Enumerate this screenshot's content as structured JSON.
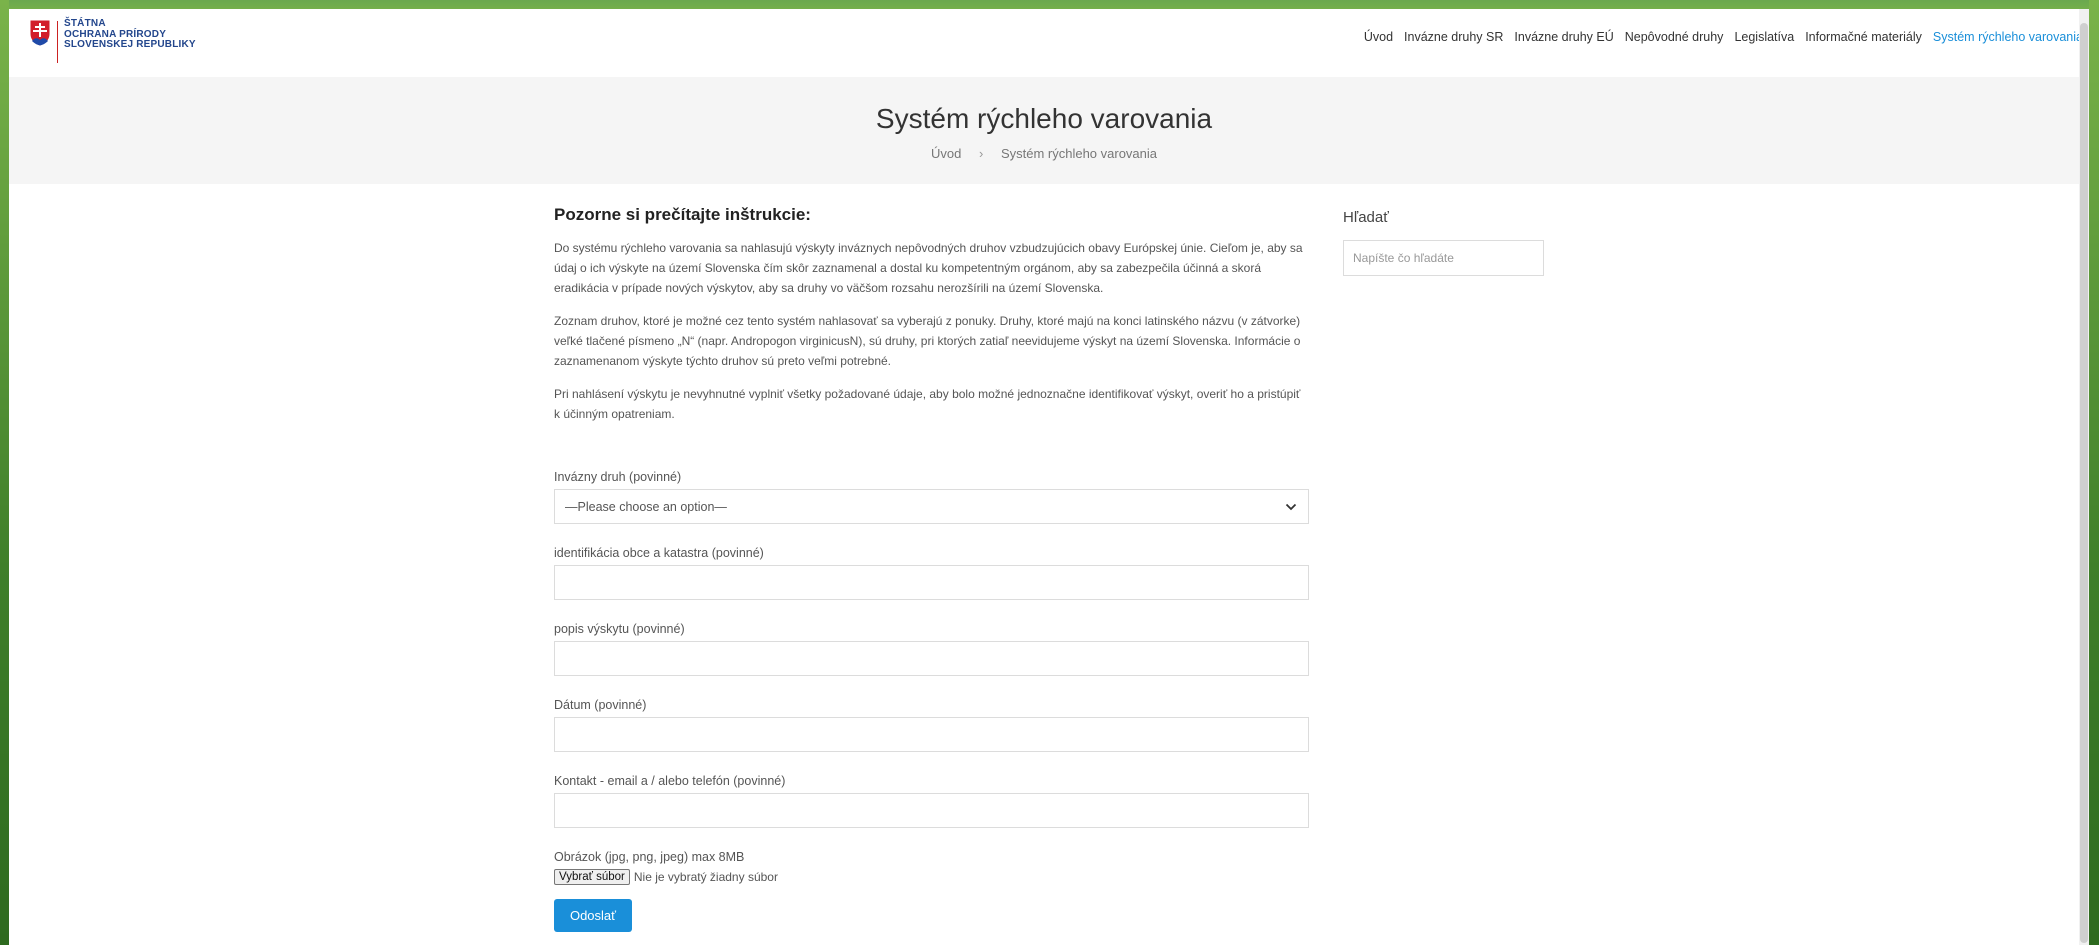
{
  "logo": {
    "line1": "ŠTÁTNA",
    "line2": "OCHRANA PRÍRODY",
    "line3": "SLOVENSKEJ REPUBLIKY"
  },
  "nav": {
    "items": [
      {
        "label": "Úvod"
      },
      {
        "label": "Invázne druhy SR"
      },
      {
        "label": "Invázne druhy EÚ"
      },
      {
        "label": "Nepôvodné druhy"
      },
      {
        "label": "Legislatíva"
      },
      {
        "label": "Informačné materiály"
      },
      {
        "label": "Systém rýchleho varovania"
      }
    ]
  },
  "page": {
    "title": "Systém rýchleho varovania",
    "breadcrumb": {
      "home": "Úvod",
      "separator": "›",
      "current": "Systém rýchleho varovania"
    }
  },
  "instructions": {
    "title": "Pozorne si prečítajte inštrukcie:",
    "paragraphs": [
      "Do systému rýchleho varovania sa nahlasujú výskyty inváznych nepôvodných druhov vzbudzujúcich obavy Európskej únie. Cieľom je, aby sa údaj o ich výskyte na území Slovenska čím skôr zaznamenal a dostal ku kompetentným orgánom, aby sa zabezpečila účinná a skorá eradikácia v prípade nových výskytov, aby sa druhy vo väčšom rozsahu nerozšírili na území Slovenska.",
      "Zoznam druhov, ktoré je možné cez tento systém nahlasovať sa vyberajú z ponuky.  Druhy, ktoré majú na konci latinského názvu (v zátvorke) veľké tlačené písmeno „N“ (napr. Andropogon virginicusN), sú druhy, pri ktorých zatiaľ neevidujeme výskyt na území Slovenska. Informácie o zaznamenanom výskyte týchto druhov sú preto veľmi potrebné.",
      "Pri nahlásení výskytu je nevyhnutné vyplniť všetky požadované údaje, aby bolo možné jednoznačne identifikovať výskyt, overiť ho a pristúpiť k účinným opatreniam."
    ]
  },
  "form": {
    "species": {
      "label": "Invázny druh (povinné)",
      "selected": "—Please choose an option—"
    },
    "municipality": {
      "label": "identifikácia obce a katastra (povinné)",
      "value": ""
    },
    "description": {
      "label": "popis výskytu (povinné)",
      "value": ""
    },
    "date": {
      "label": "Dátum (povinné)",
      "value": ""
    },
    "contact": {
      "label": "Kontakt - email a / alebo telefón (povinné)",
      "value": ""
    },
    "image": {
      "label": "Obrázok (jpg, png, jpeg) max 8MB",
      "button": "Vybrať súbor",
      "status": "Nie je vybratý žiadny súbor"
    },
    "submit": "Odoslať"
  },
  "sidebar": {
    "search_title": "Hľadať",
    "search_placeholder": "Napíšte čo hľadáte"
  },
  "colors": {
    "accent": "#1a8fd9",
    "brand_blue": "#23468c",
    "brand_red": "#c22"
  }
}
